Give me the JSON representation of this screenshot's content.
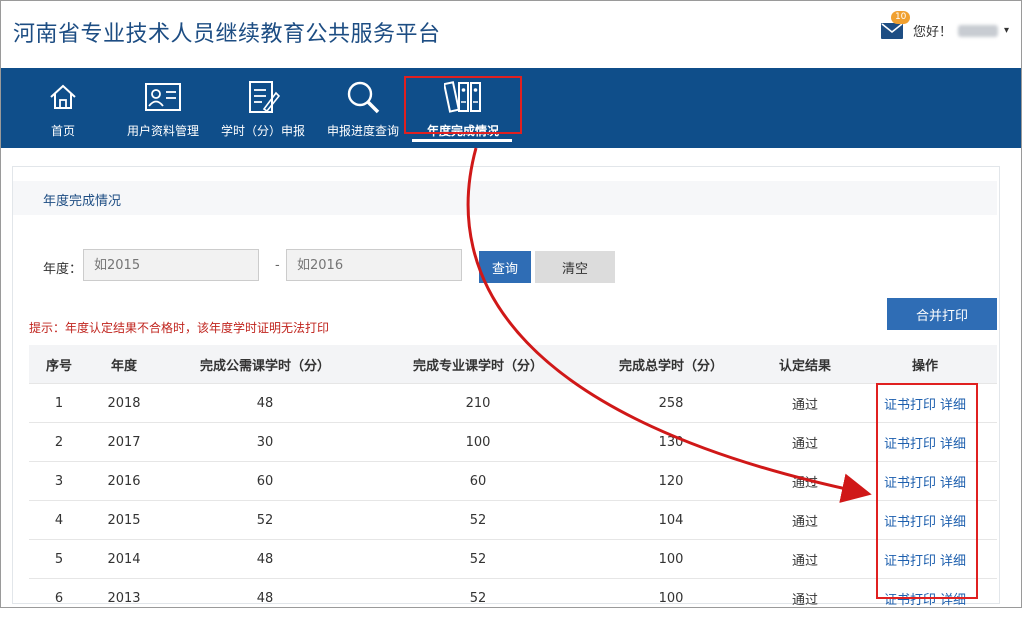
{
  "header": {
    "title": "河南省专业技术人员继续教育公共服务平台",
    "mail_count": "10",
    "greeting": "您好！",
    "caret": "▾"
  },
  "nav": {
    "items": [
      {
        "label": "首页",
        "icon": "home-icon"
      },
      {
        "label": "用户资料管理",
        "icon": "id-card-icon"
      },
      {
        "label": "学时（分）申报",
        "icon": "document-edit-icon"
      },
      {
        "label": "申报进度查询",
        "icon": "magnifier-icon"
      },
      {
        "label": "年度完成情况",
        "icon": "binders-icon",
        "active": true
      }
    ]
  },
  "panel": {
    "title": "年度完成情况"
  },
  "filter": {
    "label": "年度：",
    "from_placeholder": "如2015",
    "separator": "-",
    "to_placeholder": "如2016",
    "query_label": "查询",
    "clear_label": "清空",
    "merge_print_label": "合并打印"
  },
  "hint": "提示：年度认定结果不合格时，该年度学时证明无法打印",
  "table": {
    "headers": [
      "序号",
      "年度",
      "完成公需课学时（分）",
      "完成专业课学时（分）",
      "完成总学时（分）",
      "认定结果",
      "操作"
    ],
    "rows": [
      {
        "no": "1",
        "year": "2018",
        "public": "48",
        "pro": "210",
        "total": "258",
        "result": "通过"
      },
      {
        "no": "2",
        "year": "2017",
        "public": "30",
        "pro": "100",
        "total": "130",
        "result": "通过"
      },
      {
        "no": "3",
        "year": "2016",
        "public": "60",
        "pro": "60",
        "total": "120",
        "result": "通过"
      },
      {
        "no": "4",
        "year": "2015",
        "public": "52",
        "pro": "52",
        "total": "104",
        "result": "通过"
      },
      {
        "no": "5",
        "year": "2014",
        "public": "48",
        "pro": "52",
        "total": "100",
        "result": "通过"
      },
      {
        "no": "6",
        "year": "2013",
        "public": "48",
        "pro": "52",
        "total": "100",
        "result": "通过"
      }
    ],
    "print_label": "证书打印",
    "detail_label": "详细"
  },
  "colors": {
    "brand": "#1d4d83",
    "nav_bg": "#0f4e8a",
    "primary_button": "#2f6db5",
    "hint": "#c0241e",
    "annotation": "#e02020"
  }
}
